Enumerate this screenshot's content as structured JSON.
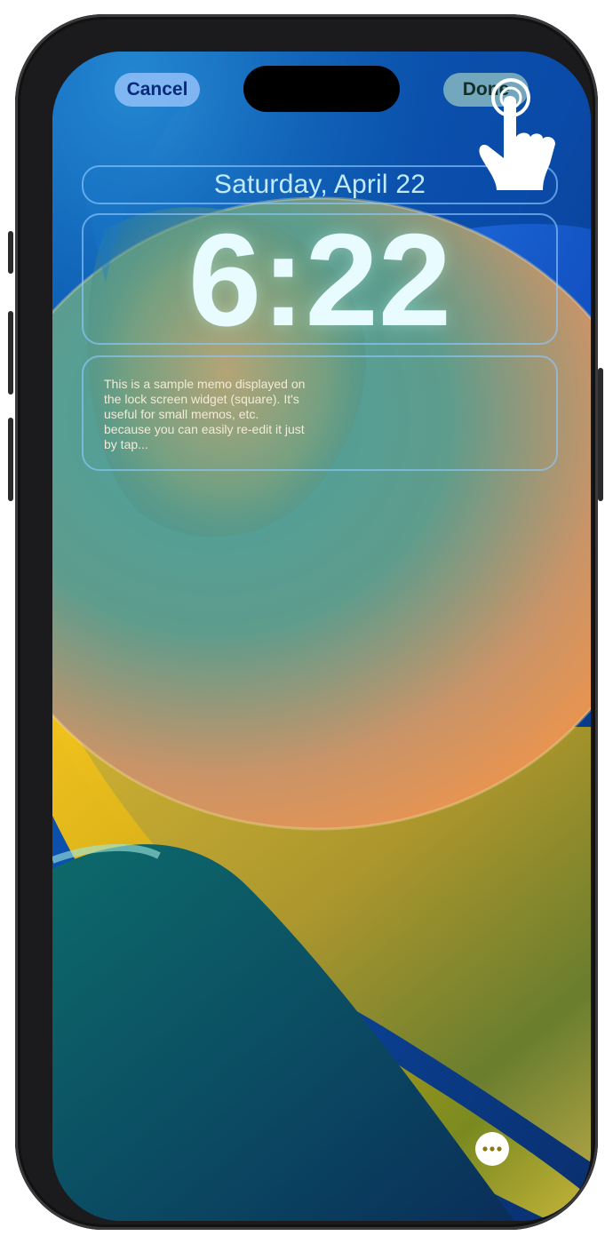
{
  "header": {
    "cancel_label": "Cancel",
    "done_label": "Done"
  },
  "lock_screen": {
    "date": "Saturday, April 22",
    "time": "6:22",
    "memo_widget_text": "This is a sample memo displayed on the lock screen widget (square). It's useful for small memos, etc. because you can easily re-edit it just by tap..."
  },
  "icons": {
    "more": "ellipsis-icon",
    "gesture": "tap-hand-icon"
  },
  "colors": {
    "cancel_text": "#0a2a7a",
    "widget_border": "#8cc8ff",
    "done_bg": "#aad7c8"
  }
}
